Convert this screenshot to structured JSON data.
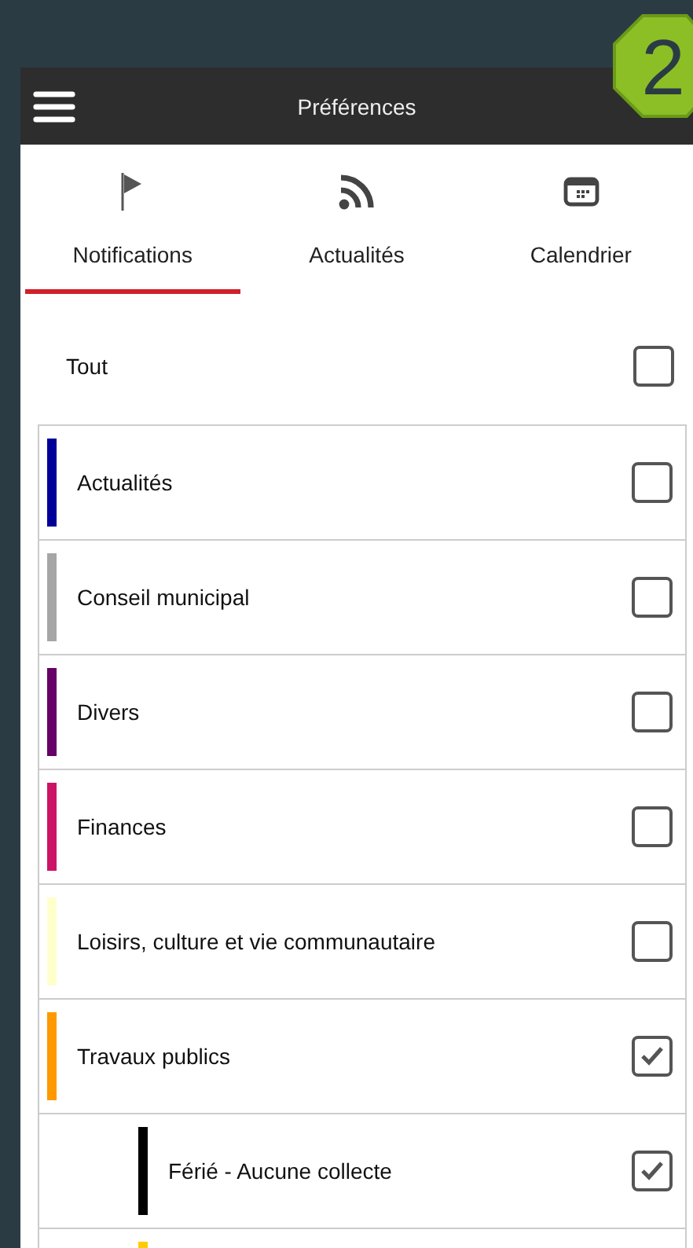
{
  "step_badge": {
    "label": "2"
  },
  "header": {
    "title": "Préférences"
  },
  "tabs": [
    {
      "label": "Notifications",
      "kind": "flag",
      "selected": true
    },
    {
      "label": "Actualités",
      "kind": "rss",
      "selected": false
    },
    {
      "label": "Calendrier",
      "kind": "calendar",
      "selected": false
    }
  ],
  "select_all": {
    "label": "Tout",
    "checked": false
  },
  "categories": [
    {
      "label": "Actualités",
      "color": "#000099",
      "checked": false
    },
    {
      "label": "Conseil municipal",
      "color": "#a6a6a6",
      "checked": false
    },
    {
      "label": "Divers",
      "color": "#660066",
      "checked": false
    },
    {
      "label": "Finances",
      "color": "#cc1466",
      "checked": false
    },
    {
      "label": "Loisirs, culture et vie communautaire",
      "color": "#ffffcc",
      "checked": false
    },
    {
      "label": "Travaux publics",
      "color": "#ff9900",
      "checked": true,
      "children": [
        {
          "label": "Férié - Aucune collecte",
          "color": "#000000",
          "checked": true
        },
        {
          "color": "#ffcc00"
        }
      ]
    }
  ]
}
